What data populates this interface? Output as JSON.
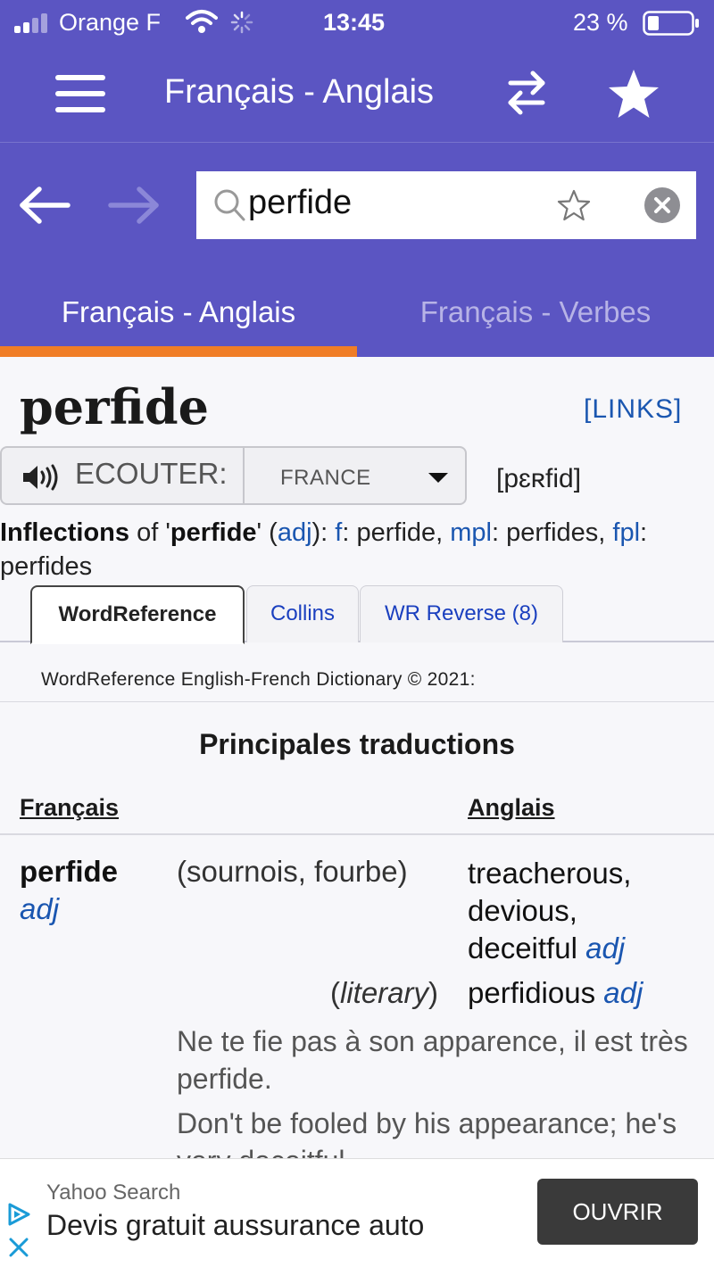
{
  "status_bar": {
    "carrier": "Orange F",
    "time": "13:45",
    "battery": "23 %"
  },
  "app_bar": {
    "title": "Français - Anglais",
    "icons": [
      "menu-icon",
      "swap-icon",
      "star-icon"
    ]
  },
  "search": {
    "query": "perfide",
    "icons": [
      "back-arrow-icon",
      "forward-arrow-icon",
      "search-icon",
      "favorite-star-icon",
      "clear-icon"
    ]
  },
  "tabs": [
    {
      "label": "Français - Anglais",
      "active": true
    },
    {
      "label": "Français - Verbes",
      "active": false
    }
  ],
  "colors": {
    "header": "#5b55c2",
    "tab_indicator": "#f07d26",
    "link": "#1a56b0"
  },
  "entry": {
    "headword": "perfide",
    "links": "[LINKS]",
    "listen_label": "ECOUTER:",
    "accent": "FRANCE",
    "ipa": "[pɛʀfid]"
  },
  "inflections": {
    "prefix": "Inflections",
    "of": " of '",
    "word": "perfide",
    "close": "' (",
    "pos": "adj",
    "after_pos": "): ",
    "f_label": "f",
    "f_value": ": perfide, ",
    "mpl_label": "mpl",
    "mpl_value": ": perfides, ",
    "fpl_label": "fpl",
    "fpl_value": ": perfides"
  },
  "dict_tabs": [
    {
      "label": "WordReference",
      "active": true
    },
    {
      "label": "Collins",
      "active": false
    },
    {
      "label": "WR Reverse (8)",
      "active": false
    }
  ],
  "dictionary": {
    "copyright": "WordReference English-French Dictionary © 2021:",
    "section_title": "Principales traductions",
    "col_source": "Français",
    "col_target": "Anglais",
    "word": "perfide",
    "pos": "adj",
    "sense": "(sournois, fourbe)",
    "translations": [
      {
        "text": "treacherous,"
      },
      {
        "text": "devious,"
      },
      {
        "text": "deceitful",
        "pos": "adj"
      }
    ],
    "literary_open": "(",
    "literary_note": "literary",
    "literary_close": ")",
    "literary_translation": "perfidious",
    "literary_pos": "adj",
    "example_fr": "Ne te fie pas à son apparence, il est très perfide.",
    "example_en": "Don't be fooled by his appearance; he's very deceitful."
  },
  "ad": {
    "source": "Yahoo Search",
    "headline": "Devis gratuit aussurance auto",
    "cta": "OUVRIR"
  }
}
